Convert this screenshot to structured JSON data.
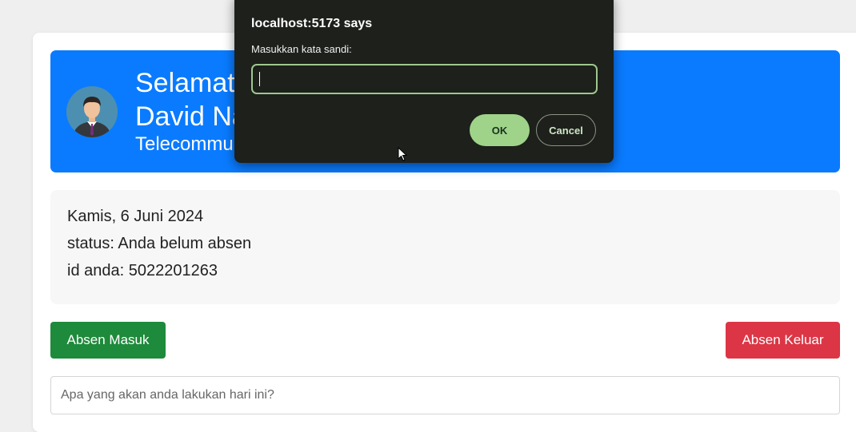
{
  "dialog": {
    "title": "localhost:5173 says",
    "message": "Masukkan kata sandi:",
    "input_value": "",
    "ok_label": "OK",
    "cancel_label": "Cancel"
  },
  "header": {
    "greeting_line1": "Selamat",
    "greeting_line2": "David Na",
    "role": "Telecommu",
    "avatar_icon": "user-avatar-icon"
  },
  "info": {
    "date": "Kamis, 6 Juni 2024",
    "status": "status: Anda belum absen",
    "id": "id anda: 5022201263"
  },
  "actions": {
    "check_in_label": "Absen Masuk",
    "check_out_label": "Absen Keluar"
  },
  "plan": {
    "placeholder": "Apa yang akan anda lakukan hari ini?",
    "value": ""
  },
  "colors": {
    "header_bg": "#0a7bff",
    "check_in": "#1e8a3b",
    "check_out": "#dc3545",
    "dialog_bg": "#1d201b",
    "dialog_accent": "#9fd38a"
  }
}
